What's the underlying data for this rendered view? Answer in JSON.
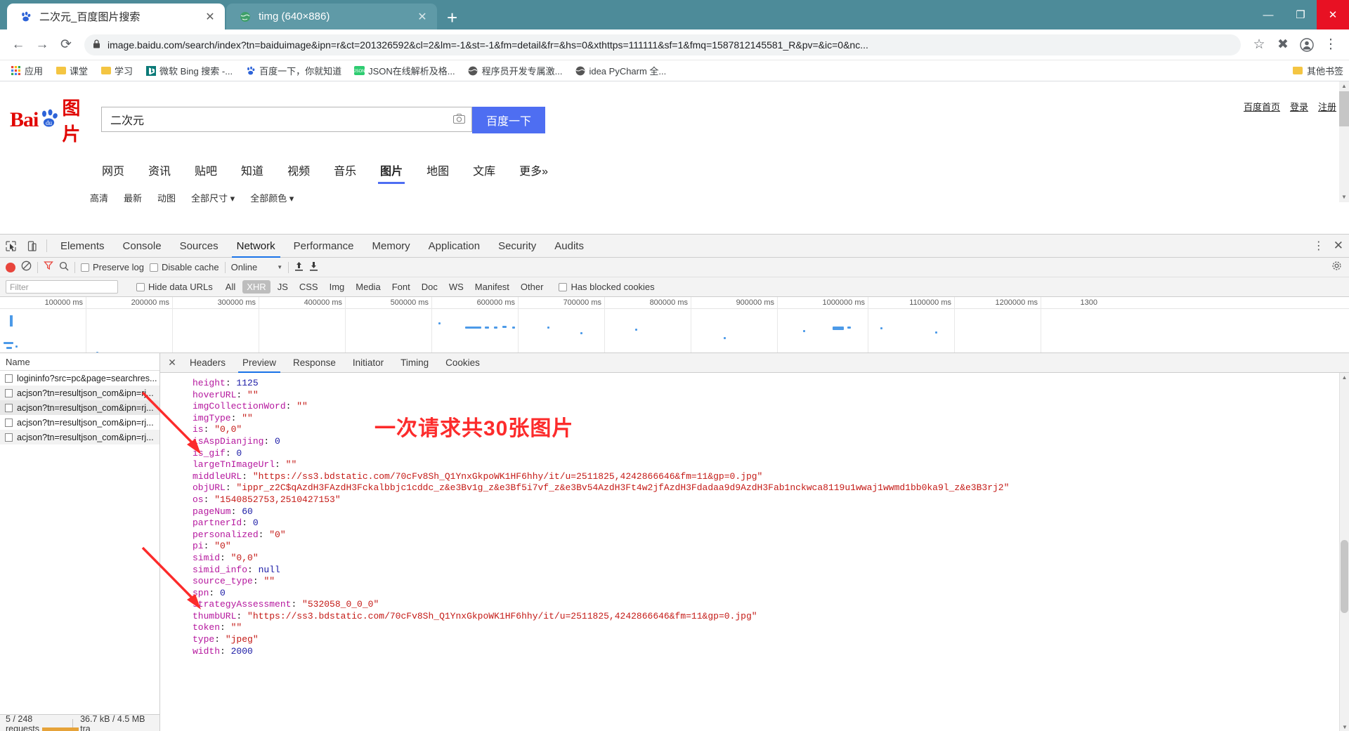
{
  "browser": {
    "tabs": [
      {
        "title": "二次元_百度图片搜索",
        "favicon": "baidu-paw-icon",
        "active": true,
        "close_label": "✕"
      },
      {
        "title": "timg (640×886)",
        "favicon": "globe-icon",
        "active": false,
        "close_label": "✕"
      }
    ],
    "new_tab_label": "+",
    "window_controls": {
      "minimize": "—",
      "maximize": "❐",
      "close": "✕"
    },
    "nav": {
      "back": "←",
      "forward": "→",
      "reload": "⟳",
      "lock": "🔒",
      "url": "image.baidu.com/search/index?tn=baiduimage&ipn=r&ct=201326592&cl=2&lm=-1&st=-1&fm=detail&fr=&hs=0&xthttps=111111&sf=1&fmq=1587812145581_R&pv=&ic=0&nc...",
      "star": "☆",
      "extension": "✖",
      "profile": "◕",
      "menu": "⋮"
    },
    "bookmarks": {
      "items": [
        {
          "label": "应用",
          "icon": "apps-grid-icon"
        },
        {
          "label": "课堂",
          "icon": "folder-icon"
        },
        {
          "label": "学习",
          "icon": "folder-icon"
        },
        {
          "label": "微软 Bing 搜索 -...",
          "icon": "bing-icon"
        },
        {
          "label": "百度一下，你就知道",
          "icon": "baidu-icon"
        },
        {
          "label": "JSON在线解析及格...",
          "icon": "json-icon"
        },
        {
          "label": "程序员开发专属激...",
          "icon": "globe-dark-icon"
        },
        {
          "label": "idea PyCharm 全...",
          "icon": "globe-dark-icon"
        }
      ],
      "other_bookmarks": {
        "label": "其他书签",
        "icon": "folder-icon"
      }
    }
  },
  "baidu": {
    "logo": {
      "bai": "Bai",
      "du": "du",
      "tu_pian": "图片"
    },
    "search": {
      "value": "二次元",
      "placeholder": "",
      "camera_icon": "camera-icon",
      "button_label": "百度一下"
    },
    "header_links": [
      "百度首页",
      "登录",
      "注册"
    ],
    "nav_tabs": [
      {
        "label": "网页",
        "selected": false
      },
      {
        "label": "资讯",
        "selected": false
      },
      {
        "label": "贴吧",
        "selected": false
      },
      {
        "label": "知道",
        "selected": false
      },
      {
        "label": "视频",
        "selected": false
      },
      {
        "label": "音乐",
        "selected": false
      },
      {
        "label": "图片",
        "selected": true
      },
      {
        "label": "地图",
        "selected": false
      },
      {
        "label": "文库",
        "selected": false
      },
      {
        "label": "更多»",
        "selected": false
      }
    ],
    "subfilters": [
      "高清",
      "最新",
      "动图",
      "全部尺寸 ▾",
      "全部颜色 ▾"
    ],
    "warn_icon": "exclamation-icon"
  },
  "devtools": {
    "tool_icons": [
      "inspect-element-icon",
      "device-toolbar-icon"
    ],
    "panels": [
      {
        "label": "Elements",
        "active": false
      },
      {
        "label": "Console",
        "active": false
      },
      {
        "label": "Sources",
        "active": false
      },
      {
        "label": "Network",
        "active": true
      },
      {
        "label": "Performance",
        "active": false
      },
      {
        "label": "Memory",
        "active": false
      },
      {
        "label": "Application",
        "active": false
      },
      {
        "label": "Security",
        "active": false
      },
      {
        "label": "Audits",
        "active": false
      }
    ],
    "panel_menu_icon": "kebab-menu-icon",
    "panel_close_icon": "close-icon",
    "network_toolbar": {
      "record_icon": "record-stop-icon",
      "clear_icon": "clear-icon",
      "filter_icon": "funnel-icon",
      "search_icon": "search-icon",
      "preserve_log": {
        "label": "Preserve log",
        "checked": false
      },
      "disable_cache": {
        "label": "Disable cache",
        "checked": false
      },
      "throttling": "Online",
      "import_icon": "upload-icon",
      "export_icon": "download-icon",
      "settings_icon": "gear-icon"
    },
    "filter_bar": {
      "filter_placeholder": "Filter",
      "hide_data_urls": {
        "label": "Hide data URLs",
        "checked": false
      },
      "types": [
        {
          "label": "All",
          "active": false
        },
        {
          "label": "XHR",
          "active": true
        },
        {
          "label": "JS",
          "active": false
        },
        {
          "label": "CSS",
          "active": false
        },
        {
          "label": "Img",
          "active": false
        },
        {
          "label": "Media",
          "active": false
        },
        {
          "label": "Font",
          "active": false
        },
        {
          "label": "Doc",
          "active": false
        },
        {
          "label": "WS",
          "active": false
        },
        {
          "label": "Manifest",
          "active": false
        },
        {
          "label": "Other",
          "active": false
        }
      ],
      "has_blocked_cookies": {
        "label": "Has blocked cookies",
        "checked": false
      }
    },
    "overview_ticks": [
      "100000 ms",
      "200000 ms",
      "300000 ms",
      "400000 ms",
      "500000 ms",
      "600000 ms",
      "700000 ms",
      "800000 ms",
      "900000 ms",
      "1000000 ms",
      "1100000 ms",
      "1200000 ms",
      "1300"
    ],
    "requests": {
      "column_header": "Name",
      "rows": [
        {
          "name": "logininfo?src=pc&page=searchres...",
          "selected": false
        },
        {
          "name": "acjson?tn=resultjson_com&ipn=rj...",
          "selected": false
        },
        {
          "name": "acjson?tn=resultjson_com&ipn=rj...",
          "selected": true
        },
        {
          "name": "acjson?tn=resultjson_com&ipn=rj...",
          "selected": false
        },
        {
          "name": "acjson?tn=resultjson_com&ipn=rj...",
          "selected": false
        }
      ],
      "status": {
        "requests": "5 / 248 requests",
        "transferred": "36.7 kB / 4.5 MB tra"
      }
    },
    "detail_tabs": [
      {
        "label": "Headers",
        "active": false
      },
      {
        "label": "Preview",
        "active": true
      },
      {
        "label": "Response",
        "active": false
      },
      {
        "label": "Initiator",
        "active": false
      },
      {
        "label": "Timing",
        "active": false
      },
      {
        "label": "Cookies",
        "active": false
      }
    ],
    "detail_close_icon": "close-icon",
    "json_lines": [
      {
        "key": "height",
        "value": "1125",
        "type": "num"
      },
      {
        "key": "hoverURL",
        "value": "\"\"",
        "type": "str"
      },
      {
        "key": "imgCollectionWord",
        "value": "\"\"",
        "type": "str"
      },
      {
        "key": "imgType",
        "value": "\"\"",
        "type": "str"
      },
      {
        "key": "is",
        "value": "\"0,0\"",
        "type": "str"
      },
      {
        "key": "isAspDianjing",
        "value": "0",
        "type": "num"
      },
      {
        "key": "is_gif",
        "value": "0",
        "type": "num"
      },
      {
        "key": "largeTnImageUrl",
        "value": "\"\"",
        "type": "str"
      },
      {
        "key": "middleURL",
        "value": "\"https://ss3.bdstatic.com/70cFv8Sh_Q1YnxGkpoWK1HF6hhy/it/u=2511825,4242866646&fm=11&gp=0.jpg\"",
        "type": "str"
      },
      {
        "key": "objURL",
        "value": "\"ippr_z2C$qAzdH3FAzdH3Fckalbbjc1cddc_z&e3Bv1g_z&e3Bf5i7vf_z&e3Bv54AzdH3Ft4w2jfAzdH3Fdadaa9d9AzdH3Fab1nckwca8119u1wwaj1wwmd1bb0ka9l_z&e3B3rj2\"",
        "type": "str"
      },
      {
        "key": "os",
        "value": "\"1540852753,2510427153\"",
        "type": "str"
      },
      {
        "key": "pageNum",
        "value": "60",
        "type": "num"
      },
      {
        "key": "partnerId",
        "value": "0",
        "type": "num"
      },
      {
        "key": "personalized",
        "value": "\"0\"",
        "type": "str"
      },
      {
        "key": "pi",
        "value": "\"0\"",
        "type": "str"
      },
      {
        "key": "simid",
        "value": "\"0,0\"",
        "type": "str"
      },
      {
        "key": "simid_info",
        "value": "null",
        "type": "null"
      },
      {
        "key": "source_type",
        "value": "\"\"",
        "type": "str"
      },
      {
        "key": "spn",
        "value": "0",
        "type": "num"
      },
      {
        "key": "strategyAssessment",
        "value": "\"532058_0_0_0\"",
        "type": "str"
      },
      {
        "key": "thumbURL",
        "value": "\"https://ss3.bdstatic.com/70cFv8Sh_Q1YnxGkpoWK1HF6hhy/it/u=2511825,4242866646&fm=11&gp=0.jpg\"",
        "type": "str"
      },
      {
        "key": "token",
        "value": "\"\"",
        "type": "str"
      },
      {
        "key": "type",
        "value": "\"jpeg\"",
        "type": "str"
      },
      {
        "key": "width",
        "value": "2000",
        "type": "num"
      }
    ],
    "annotation": {
      "text": "一次请求共30张图片",
      "color": "#fc2b2b",
      "arrows": 2
    }
  }
}
